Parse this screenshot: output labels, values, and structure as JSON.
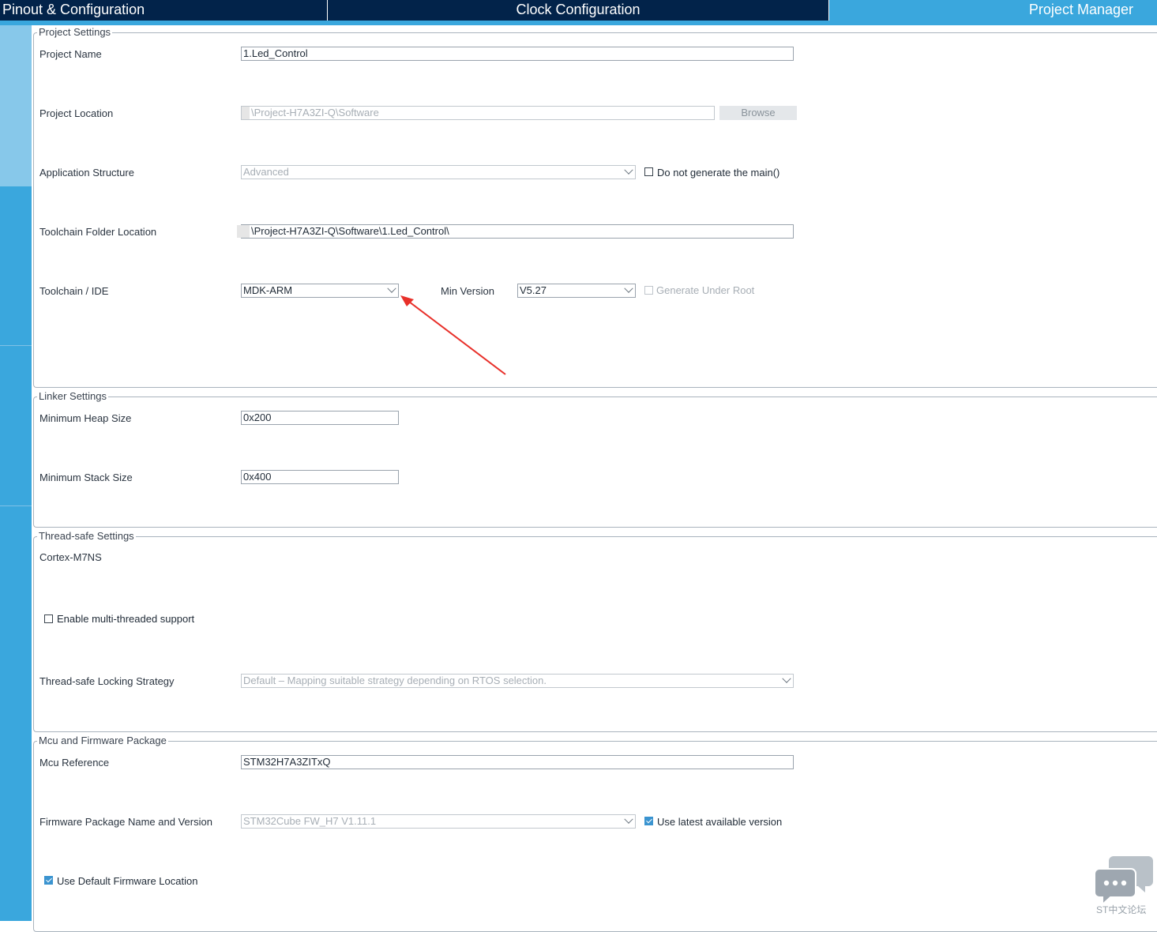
{
  "tabs": [
    {
      "label": "Pinout & Configuration"
    },
    {
      "label": "Clock Configuration"
    },
    {
      "label": "Project Manager"
    }
  ],
  "project_settings": {
    "title": "Project Settings",
    "project_name": {
      "label": "Project Name",
      "value": "1.Led_Control"
    },
    "project_location": {
      "label": "Project Location",
      "value": "\\Project-H7A3ZI-Q\\Software",
      "browse_label": "Browse"
    },
    "application_structure": {
      "label": "Application Structure",
      "value": "Advanced",
      "checkbox_label": "Do not generate the main()",
      "checkbox_checked": false
    },
    "toolchain_folder": {
      "label": "Toolchain Folder Location",
      "value": "\\Project-H7A3ZI-Q\\Software\\1.Led_Control\\"
    },
    "toolchain_ide": {
      "label": "Toolchain / IDE",
      "value": "MDK-ARM",
      "min_version_label": "Min Version",
      "min_version_value": "V5.27",
      "generate_under_root_label": "Generate Under Root",
      "generate_under_root_checked": false
    }
  },
  "linker_settings": {
    "title": "Linker Settings",
    "heap": {
      "label": "Minimum Heap Size",
      "value": "0x200"
    },
    "stack": {
      "label": "Minimum Stack Size",
      "value": "0x400"
    }
  },
  "thread_safe": {
    "title": "Thread-safe Settings",
    "core": "Cortex-M7NS",
    "multithread_label": "Enable multi-threaded support",
    "multithread_checked": false,
    "strategy_label": "Thread-safe Locking Strategy",
    "strategy_value": "Default  –  Mapping suitable strategy depending on RTOS selection."
  },
  "mcu_firmware": {
    "title": "Mcu and Firmware Package",
    "mcu_reference": {
      "label": "Mcu Reference",
      "value": "STM32H7A3ZITxQ"
    },
    "firmware_package": {
      "label": "Firmware Package Name and Version",
      "value": "STM32Cube FW_H7 V1.11.1",
      "latest_label": "Use latest available version",
      "latest_checked": true
    },
    "default_location_label": "Use Default Firmware Location",
    "default_location_checked": true
  },
  "watermark": {
    "text": "ST中文论坛",
    "icon": "chat-bubbles-icon"
  },
  "annotation": {
    "icon": "red-arrow-annotation",
    "color": "#e8302a"
  },
  "colors": {
    "header_dark": "#02234a",
    "accent_blue": "#3aa7dd",
    "sidebar_light": "#87c8ea",
    "check_blue": "#3b94d0"
  }
}
